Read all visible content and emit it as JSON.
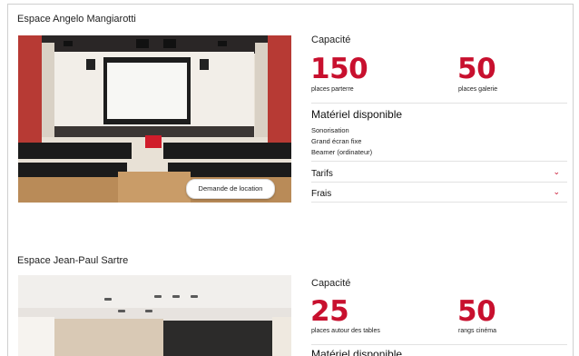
{
  "spaces": [
    {
      "title": "Espace Angelo Mangiarotti",
      "capacity_label": "Capacité",
      "cap1_value": "150",
      "cap1_label": "places parterre",
      "cap2_value": "50",
      "cap2_label": "places galerie",
      "equipment_title": "Matériel disponible",
      "equipment": [
        "Sonorisation",
        "Grand écran fixe",
        "Beamer (ordinateur)"
      ],
      "accordions": [
        "Tarifs",
        "Frais"
      ],
      "cta_label": "Demande de location"
    },
    {
      "title": "Espace Jean-Paul Sartre",
      "capacity_label": "Capacité",
      "cap1_value": "25",
      "cap1_label": "places autour des tables",
      "cap2_value": "50",
      "cap2_label": "rangs cinéma",
      "equipment_title": "Matériel disponible"
    }
  ],
  "icons": {
    "accordion_chevron": "chevron-down-icon"
  },
  "colors": {
    "accent": "#c8102e"
  }
}
